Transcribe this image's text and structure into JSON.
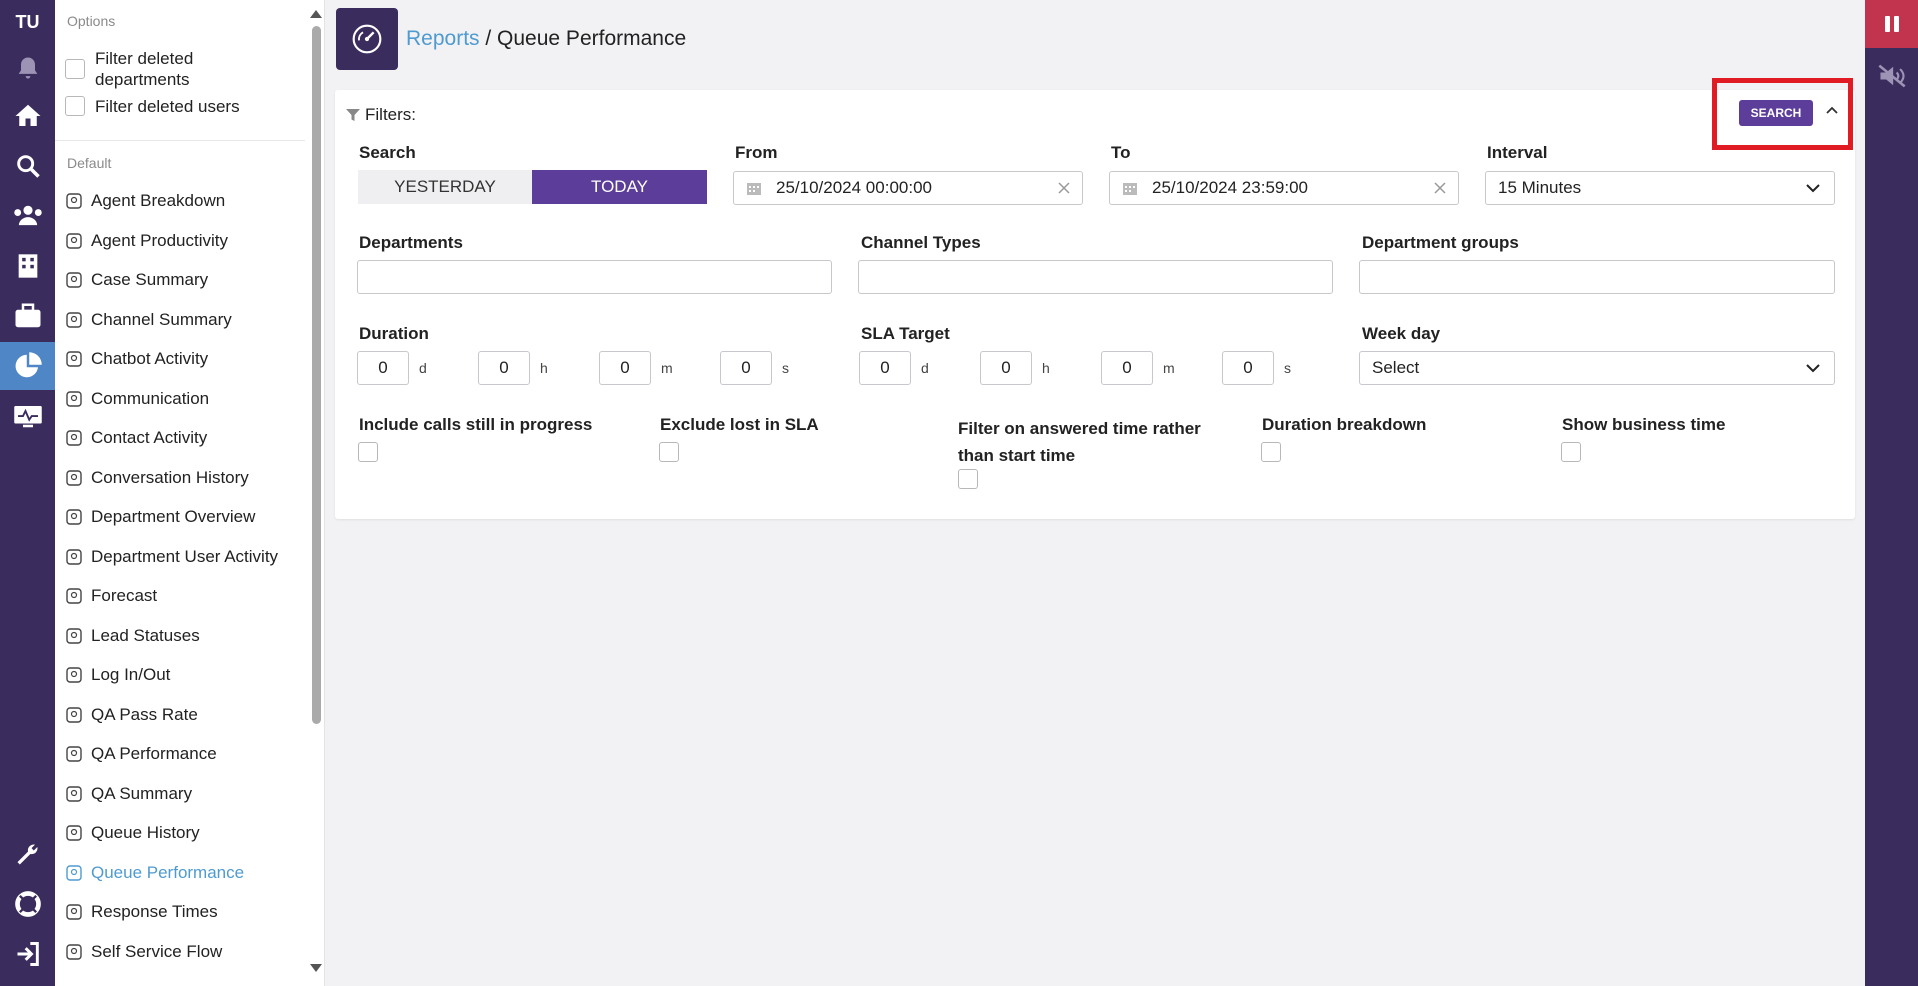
{
  "rail": {
    "brand": "TU",
    "icons": [
      "bell-icon",
      "home-icon",
      "search-icon",
      "users-icon",
      "building-icon",
      "briefcase-icon",
      "pie-chart-icon",
      "monitor-icon",
      "wrench-icon",
      "lifebuoy-icon",
      "logout-icon"
    ],
    "active": "pie-chart-icon",
    "accent": "#4f86c6"
  },
  "sidebar": {
    "options_heading": "Options",
    "filter_deleted_departments": "Filter deleted departments",
    "filter_deleted_users": "Filter deleted users",
    "default_heading": "Default",
    "items": [
      {
        "label": "Agent Breakdown",
        "icon": "user-breakdown-icon"
      },
      {
        "label": "Agent Productivity",
        "icon": "badge-icon"
      },
      {
        "label": "Case Summary",
        "icon": "briefcase-icon"
      },
      {
        "label": "Channel Summary",
        "icon": "area-chart-icon"
      },
      {
        "label": "Chatbot Activity",
        "icon": "sigma-icon"
      },
      {
        "label": "Communication",
        "icon": "group-icon"
      },
      {
        "label": "Contact Activity",
        "icon": "contact-card-icon"
      },
      {
        "label": "Conversation History",
        "icon": "history-icon"
      },
      {
        "label": "Department Overview",
        "icon": "buildings-icon"
      },
      {
        "label": "Department User Activity",
        "icon": "user-clock-icon"
      },
      {
        "label": "Forecast",
        "icon": "forecast-icon"
      },
      {
        "label": "Lead Statuses",
        "icon": "list-status-icon"
      },
      {
        "label": "Log In/Out",
        "icon": "login-icon"
      },
      {
        "label": "QA Pass Rate",
        "icon": "doc-check-icon"
      },
      {
        "label": "QA Performance",
        "icon": "doc-chart-icon"
      },
      {
        "label": "QA Summary",
        "icon": "doc-list-icon"
      },
      {
        "label": "Queue History",
        "icon": "watch-icon"
      },
      {
        "label": "Queue Performance",
        "icon": "gauge-icon",
        "active": true
      },
      {
        "label": "Response Times",
        "icon": "stopwatch-icon"
      },
      {
        "label": "Self Service Flow",
        "icon": "robot-icon"
      }
    ]
  },
  "header": {
    "breadcrumb_parent": "Reports",
    "separator": " / ",
    "title": "Queue Performance"
  },
  "filters": {
    "heading": "Filters:",
    "search_button": "SEARCH",
    "search_label": "Search",
    "yesterday": "YESTERDAY",
    "today": "TODAY",
    "from_label": "From",
    "from_value": "25/10/2024 00:00:00",
    "to_label": "To",
    "to_value": "25/10/2024 23:59:00",
    "interval_label": "Interval",
    "interval_value": "15 Minutes",
    "departments_label": "Departments",
    "channel_types_label": "Channel Types",
    "department_groups_label": "Department groups",
    "duration_label": "Duration",
    "sla_label": "SLA Target",
    "week_day_label": "Week day",
    "week_day_value": "Select",
    "duration": [
      {
        "v": "0",
        "u": "d"
      },
      {
        "v": "0",
        "u": "h"
      },
      {
        "v": "0",
        "u": "m"
      },
      {
        "v": "0",
        "u": "s"
      }
    ],
    "sla": [
      {
        "v": "0",
        "u": "d"
      },
      {
        "v": "0",
        "u": "h"
      },
      {
        "v": "0",
        "u": "m"
      },
      {
        "v": "0",
        "u": "s"
      }
    ],
    "include_calls": "Include calls still in progress",
    "exclude_lost": "Exclude lost in SLA",
    "filter_answered": "Filter on answered time rather than start time",
    "duration_breakdown": "Duration breakdown",
    "show_business_time": "Show business time"
  },
  "colors": {
    "primary": "#5c3d9a",
    "rail": "#3b2c5e",
    "link": "#4f9bd0",
    "highlight": "#e01b24"
  }
}
